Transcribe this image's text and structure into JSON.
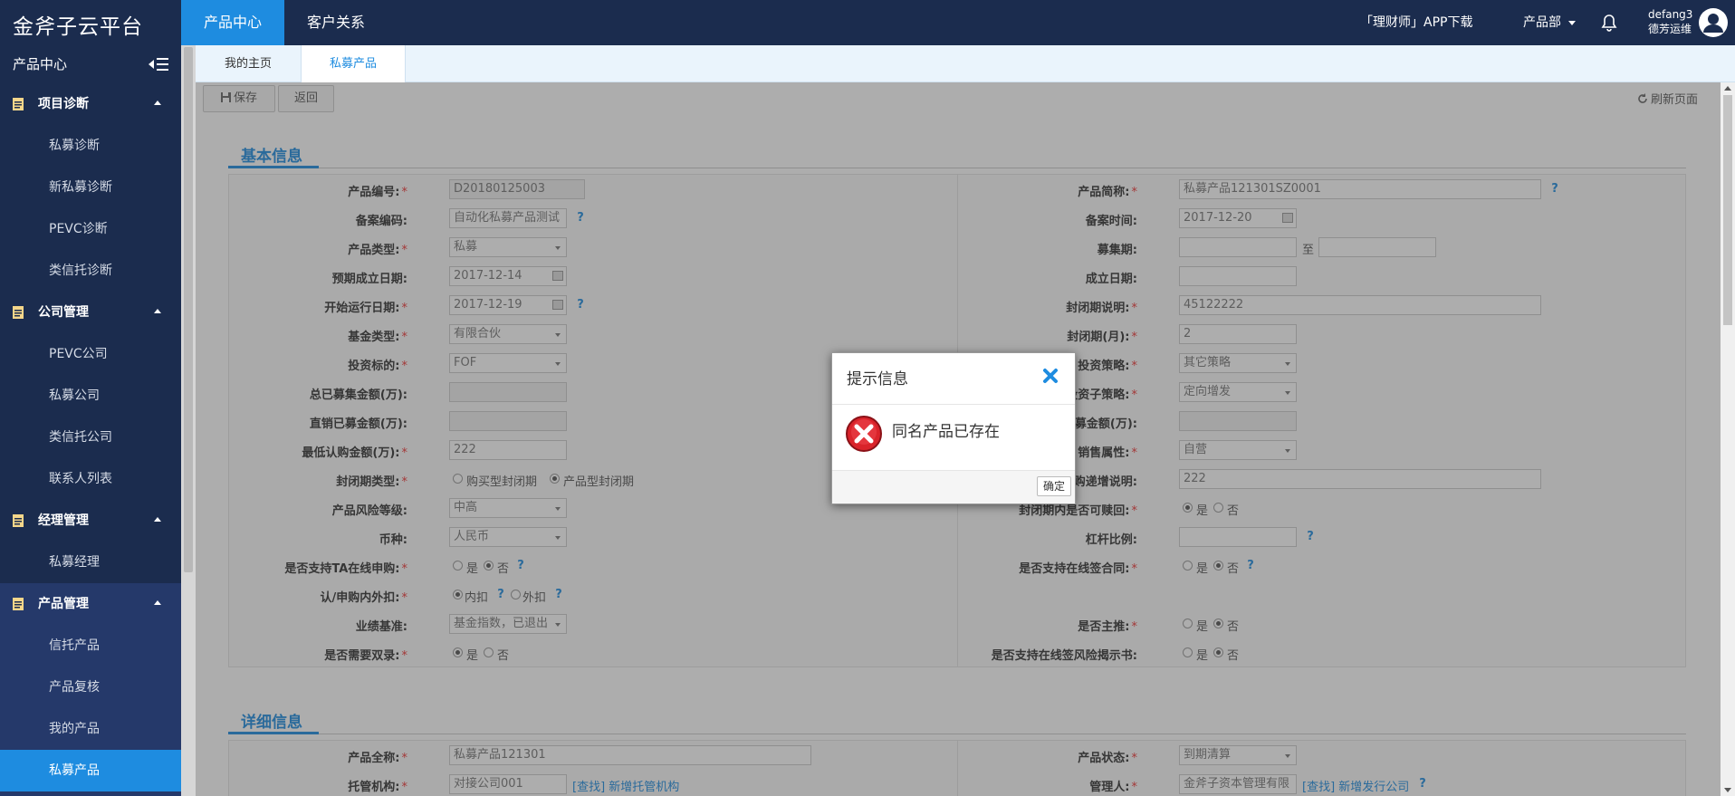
{
  "app": {
    "title": "金斧子云平台"
  },
  "topnav": {
    "tabs": [
      "产品中心",
      "客户关系"
    ],
    "app_download": "「理财师」APP下载",
    "department": "产品部",
    "user_name": "defang3",
    "user_display": "德芳运维"
  },
  "sidebar": {
    "title": "产品中心",
    "groups": [
      {
        "label": "项目诊断",
        "items": [
          "私募诊断",
          "新私募诊断",
          "PEVC诊断",
          "类信托诊断"
        ]
      },
      {
        "label": "公司管理",
        "items": [
          "PEVC公司",
          "私募公司",
          "类信托公司",
          "联系人列表"
        ]
      },
      {
        "label": "经理管理",
        "items": [
          "私募经理"
        ]
      },
      {
        "label": "产品管理",
        "items": [
          "信托产品",
          "产品复核",
          "我的产品",
          "私募产品"
        ]
      }
    ]
  },
  "tabs": [
    "我的主页",
    "私募产品"
  ],
  "toolbar": {
    "save": "保存",
    "back": "返回",
    "refresh": "刷新页面"
  },
  "basic": {
    "title": "基本信息",
    "product_code": {
      "label": "产品编号:",
      "value": "D20180125003"
    },
    "product_short": {
      "label": "产品简称:",
      "value": "私募产品121301SZ0001"
    },
    "record_code": {
      "label": "备案编码:",
      "value": "自动化私募产品测试"
    },
    "record_time": {
      "label": "备案时间:",
      "value": "2017-12-20"
    },
    "product_type": {
      "label": "产品类型:",
      "value": "私募"
    },
    "raise_period": {
      "label": "募集期:",
      "to": "至"
    },
    "expected_setup": {
      "label": "预期成立日期:",
      "value": "2017-12-14"
    },
    "setup_date": {
      "label": "成立日期:"
    },
    "start_run": {
      "label": "开始运行日期:",
      "value": "2017-12-19"
    },
    "lock_desc": {
      "label": "封闭期说明:",
      "value": "45122222"
    },
    "fund_type": {
      "label": "基金类型:",
      "value": "有限合伙"
    },
    "lock_month": {
      "label": "封闭期(月):",
      "value": "2"
    },
    "invest_target": {
      "label": "投资标的:",
      "value": "FOF"
    },
    "strategy": {
      "label": "投资策略:",
      "value": "其它策略"
    },
    "total_raised": {
      "label": "总已募集金额(万):"
    },
    "sub_strategy": {
      "label": "投资子策略:",
      "value": "定向增发"
    },
    "direct_raised": {
      "label": "直销已募金额(万):"
    },
    "agency_raised": {
      "label": "代销已募金额(万):"
    },
    "min_buy": {
      "label": "最低认购金额(万):",
      "value": "222"
    },
    "sales_attr": {
      "label": "销售属性:",
      "value": "自营"
    },
    "lock_type": {
      "label": "封闭期类型:",
      "opt1": "购买型封闭期",
      "opt2": "产品型封闭期"
    },
    "buy_incr": {
      "label": "认购递增说明:",
      "value": "222"
    },
    "risk_level": {
      "label": "产品风险等级:",
      "value": "中高"
    },
    "redeem_in_lock": {
      "label": "封闭期内是否可赎回:",
      "yes": "是",
      "no": "否"
    },
    "currency": {
      "label": "币种:",
      "value": "人民币"
    },
    "leverage": {
      "label": "杠杆比例:"
    },
    "ta_online": {
      "label": "是否支持TA在线申购:",
      "yes": "是",
      "no": "否"
    },
    "online_sign": {
      "label": "是否支持在线签合同:",
      "yes": "是",
      "no": "否"
    },
    "fee_inout": {
      "label": "认/申购内外扣:",
      "opt1": "内扣",
      "opt2": "外扣"
    },
    "benchmark": {
      "label": "业绩基准:",
      "value": "基金指数，已退出"
    },
    "main_push": {
      "label": "是否主推:",
      "yes": "是",
      "no": "否"
    },
    "double_record": {
      "label": "是否需要双录:",
      "yes": "是",
      "no": "否"
    },
    "risk_sign": {
      "label": "是否支持在线签风险揭示书:",
      "yes": "是",
      "no": "否"
    }
  },
  "detail": {
    "title": "详细信息",
    "full_name": {
      "label": "产品全称:",
      "value": "私募产品121301"
    },
    "status": {
      "label": "产品状态:",
      "value": "到期清算"
    },
    "custodian": {
      "label": "托管机构:",
      "value": "对接公司001",
      "links": "[查找] 新增托管机构"
    },
    "manager": {
      "label": "管理人:",
      "value": "金斧子资本管理有限",
      "links": "[查找] 新增发行公司"
    }
  },
  "dialog": {
    "title": "提示信息",
    "message": "同名产品已存在",
    "ok": "确定"
  },
  "colors": {
    "navy": "#1b2c4e",
    "accent": "#1e8ce0",
    "required": "#e33333"
  }
}
